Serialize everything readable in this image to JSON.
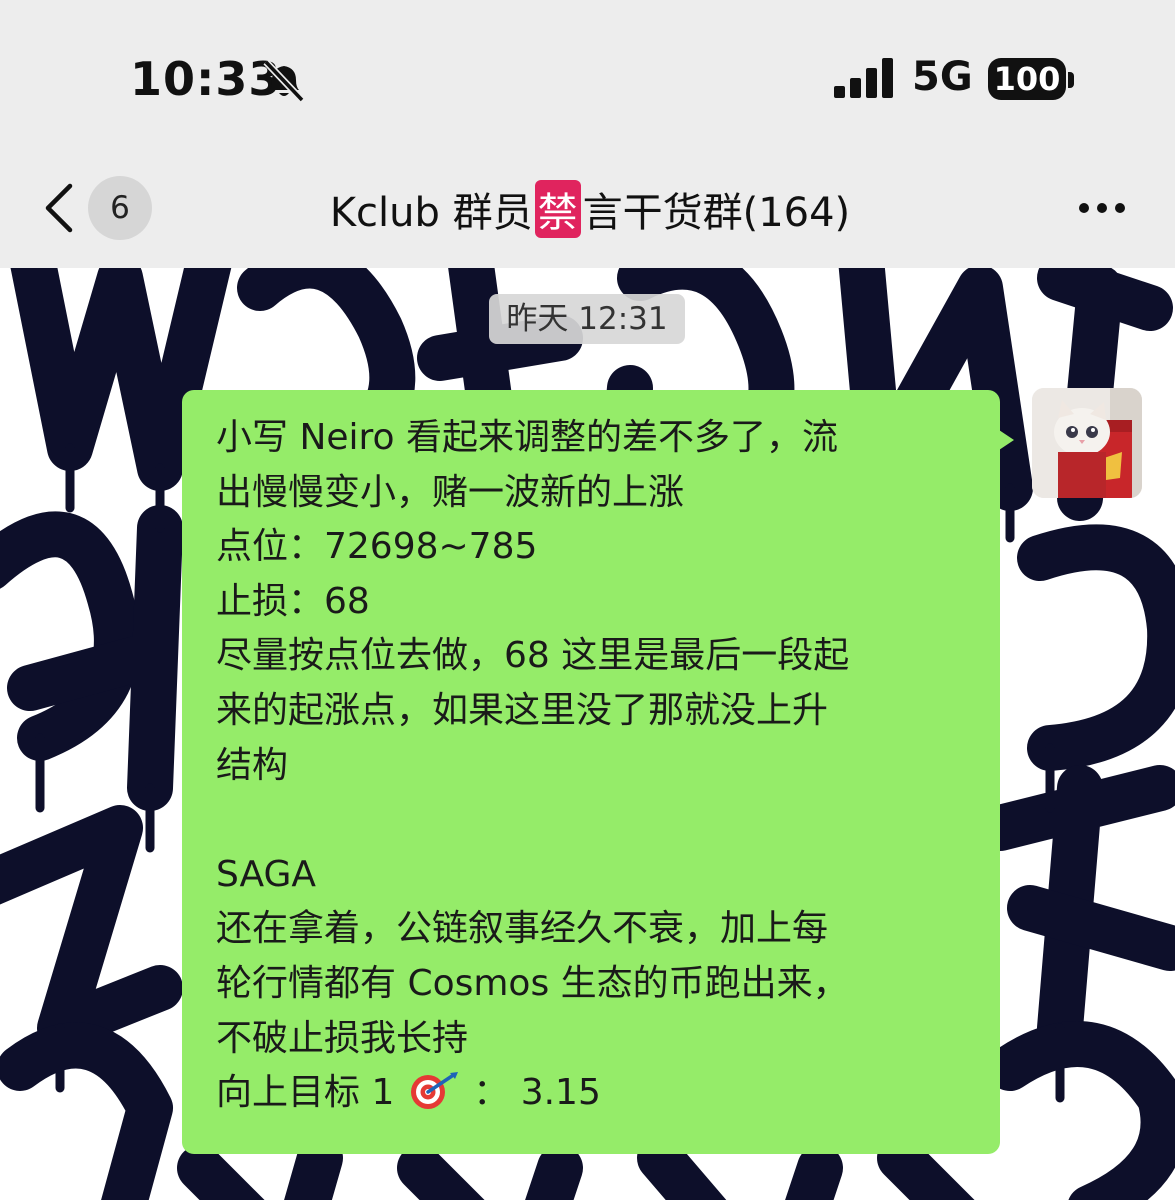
{
  "status_bar": {
    "time": "10:33",
    "network": "5G",
    "battery": "100"
  },
  "nav": {
    "unread_count": "6",
    "title_before": "Kclub 群员",
    "title_ban_char": "禁",
    "title_after": "言干货群(164)"
  },
  "chat": {
    "timestamp": "昨天 12:31",
    "message_lines": [
      "小写 Neiro 看起来调整的差不多了，流",
      "出慢慢变小，赌一波新的上涨",
      "点位：72698~785",
      "止损：68",
      "尽量按点位去做，68 这里是最后一段起",
      "来的起涨点，如果这里没了那就没上升",
      "结构",
      "",
      "SAGA",
      "还在拿着，公链叙事经久不衰，加上每",
      "轮行情都有 Cosmos 生态的币跑出来，",
      "不破止损我长持"
    ],
    "target_before": "向上目标 1",
    "target_after": "：  3.15"
  },
  "colors": {
    "header_bg": "#ededed",
    "bubble_bg": "#95ec69",
    "wallpaper_ink": "#0d0f2a",
    "ban_badge": "#e0245e"
  },
  "icons": {
    "mute": "bell-slash-icon",
    "signal": "cellular-signal-icon",
    "back": "chevron-left-icon",
    "more": "ellipsis-icon",
    "target": "dart-target-emoji"
  }
}
